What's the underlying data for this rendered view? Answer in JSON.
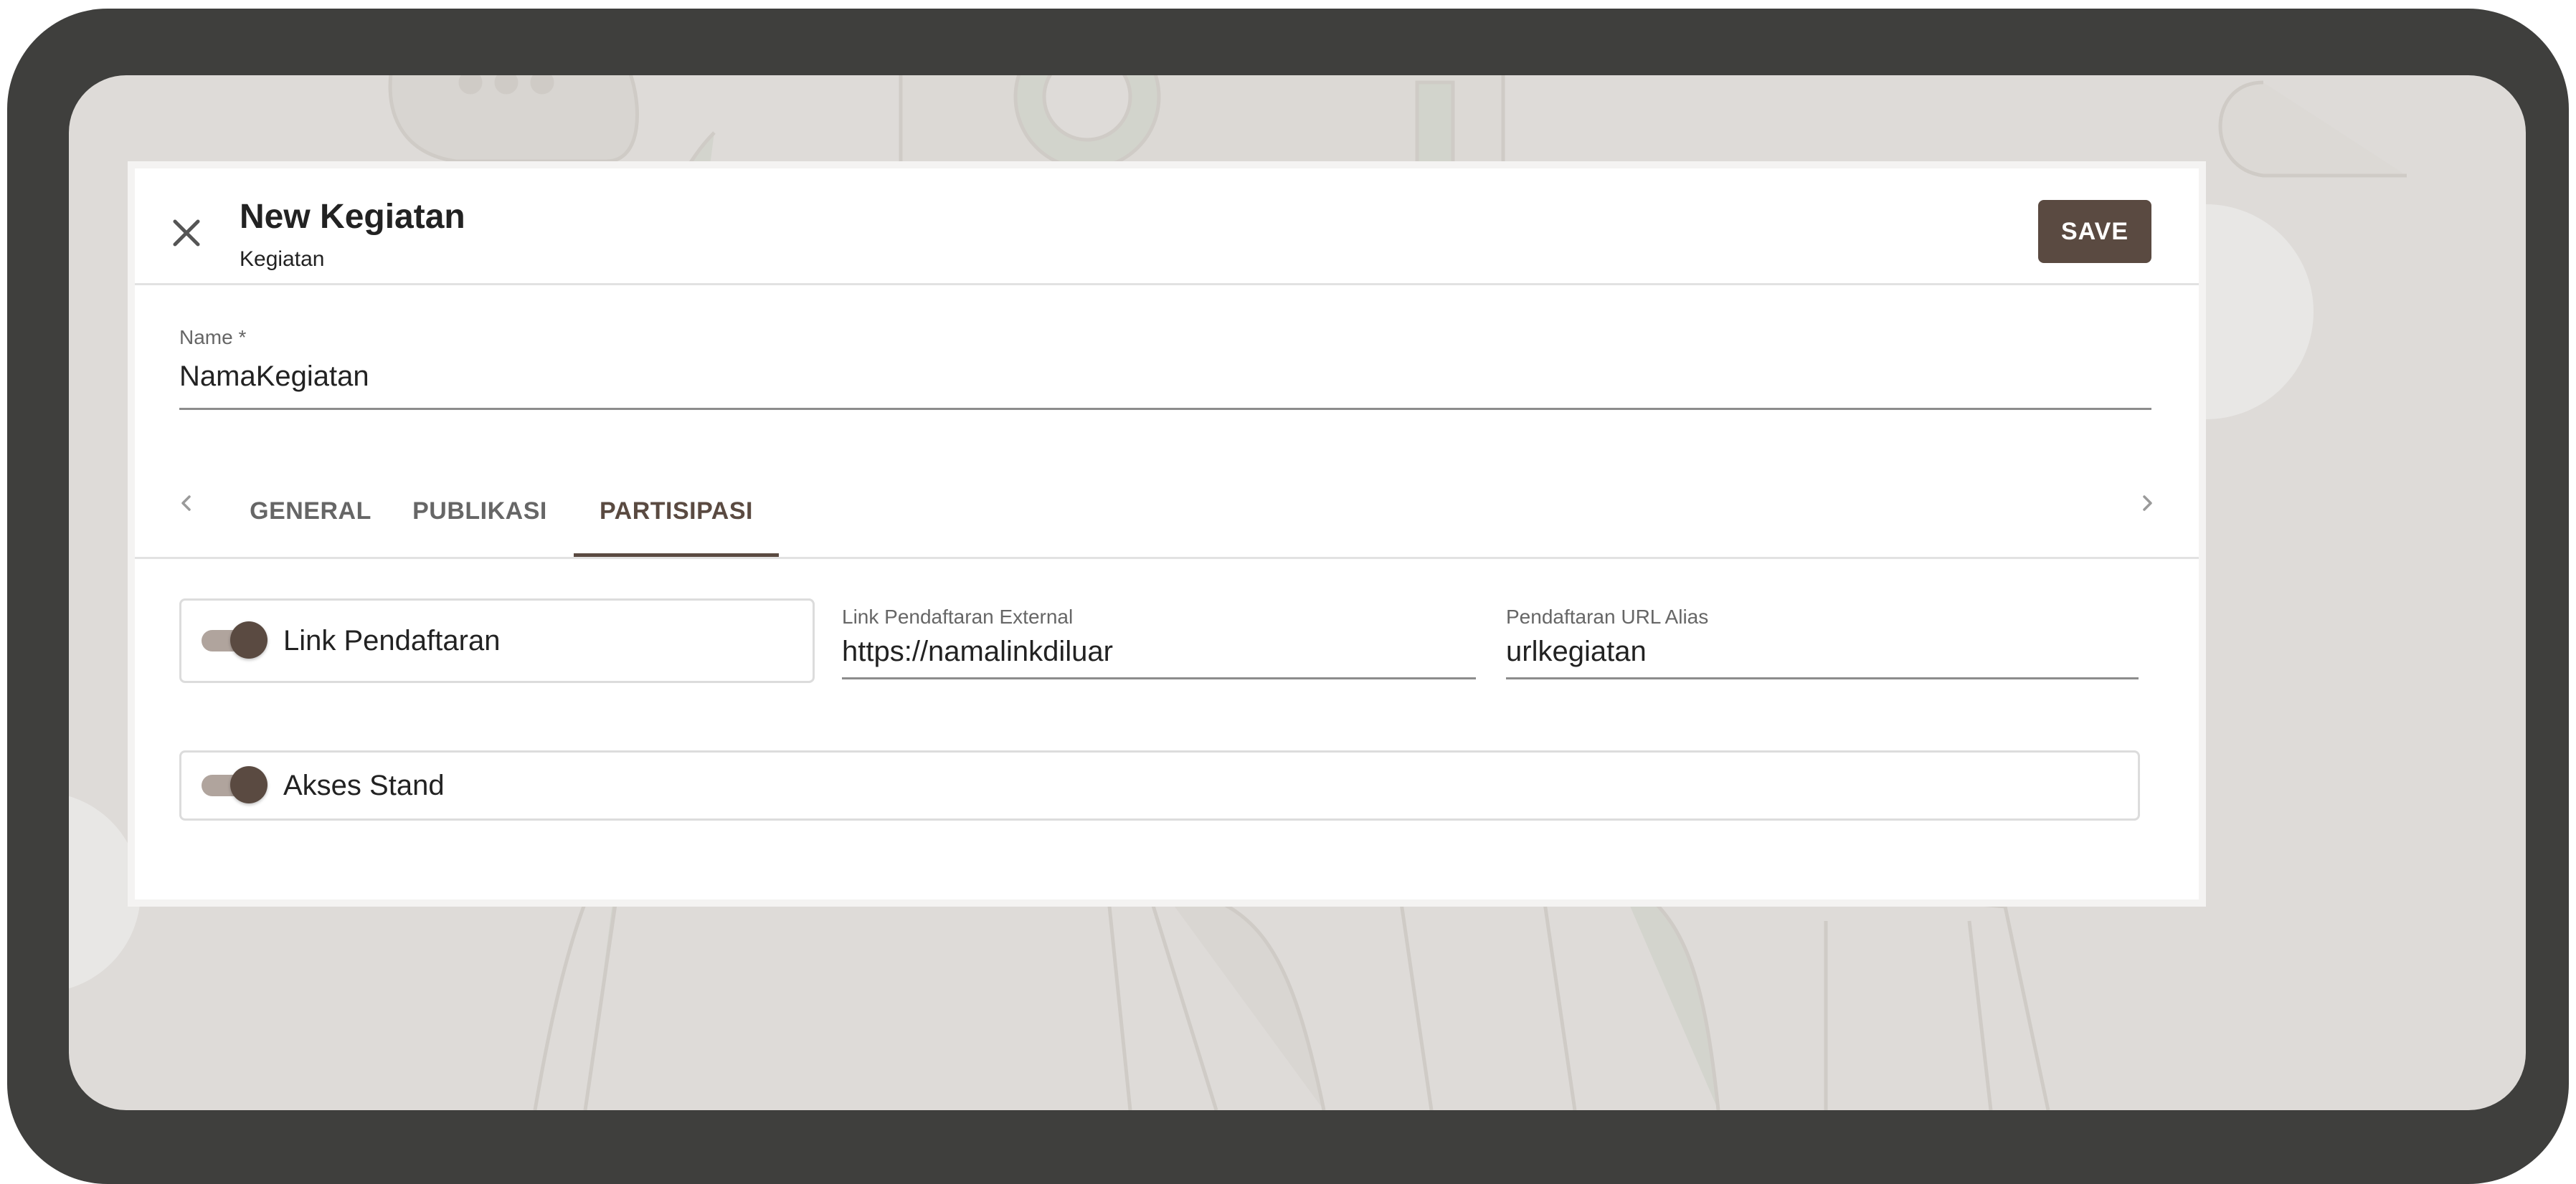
{
  "dialog": {
    "title": "New Kegiatan",
    "subtitle": "Kegiatan",
    "save_label": "SAVE"
  },
  "name_field": {
    "label": "Name *",
    "value": "NamaKegiatan"
  },
  "tabs": [
    {
      "label": "GENERAL",
      "active": false
    },
    {
      "label": "PUBLIKASI",
      "active": false
    },
    {
      "label": "PARTISIPASI",
      "active": true
    }
  ],
  "partisipasi": {
    "link_pendaftaran": {
      "label": "Link Pendaftaran",
      "enabled": true
    },
    "link_external": {
      "label": "Link Pendaftaran External",
      "value": "https://namalinkdiluar"
    },
    "url_alias": {
      "label": "Pendaftaran URL Alias",
      "value": "urlkegiatan"
    },
    "akses_stand": {
      "label": "Akses Stand",
      "enabled": true
    }
  },
  "icons": {
    "close": "close-icon",
    "prev": "chevron-left-icon",
    "next": "chevron-right-icon"
  },
  "colors": {
    "primary": "#5a4a41",
    "switch_track": "#b0a49d",
    "frame": "#3f3f3d",
    "screen_bg": "#dedbd8"
  }
}
